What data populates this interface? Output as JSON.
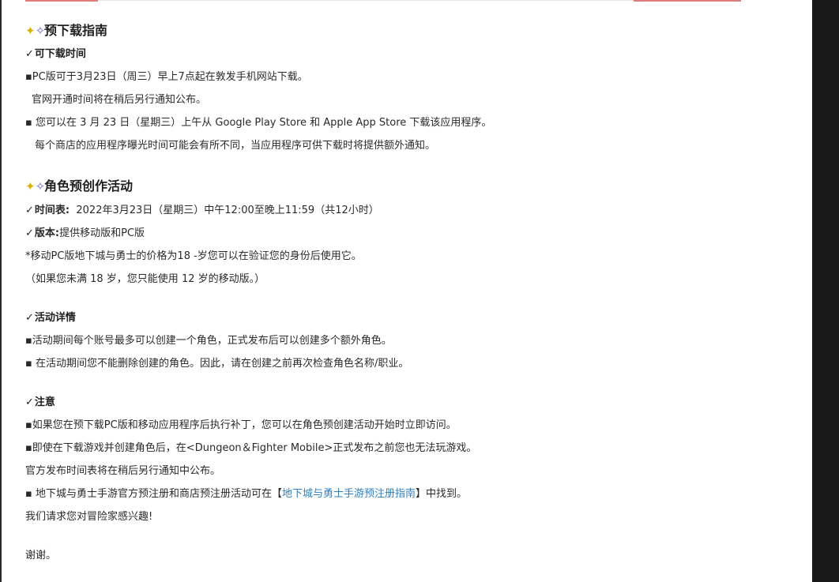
{
  "section1": {
    "title": "预下载指南",
    "subheading": "可下载时间",
    "lines": [
      "▪PC版可于3月23日（周三）早上7点起在敦发手机网站下载。",
      "官网开通时间将在稍后另行通知公布。",
      "▪ 您可以在 3 月 23 日（星期三）上午从 Google Play Store 和 Apple App Store 下载该应用程序。",
      "每个商店的应用程序曝光时间可能会有所不同，当应用程序可供下载时将提供额外通知。"
    ]
  },
  "section2": {
    "title": "角色预创作活动",
    "schedule_label": "时间表:",
    "schedule_value": "2022年3月23日（星期三）中午12:00至晚上11:59（共12小时）",
    "version_label": "版本:",
    "version_value": "提供移动版和PC版",
    "notes": [
      "*移动PC版地下城与勇士的价格为18 -岁您可以在验证您的身份后使用它。",
      "（如果您未满 18 岁，您只能使用 12 岁的移动版。）"
    ]
  },
  "section3": {
    "subheading": "活动详情",
    "lines": [
      "▪活动期间每个账号最多可以创建一个角色，正式发布后可以创建多个额外角色。",
      "▪ 在活动期间您不能删除创建的角色。因此，请在创建之前再次检查角色名称/职业。"
    ]
  },
  "section4": {
    "subheading": "注意",
    "lines": [
      "▪如果您在预下载PC版和移动应用程序后执行补丁，您可以在角色预创建活动开始时立即访问。",
      "▪即使在下载游戏并创建角色后，在<Dungeon＆Fighter Mobile>正式发布之前您也无法玩游戏。",
      "官方发布时间表将在稍后另行通知中公布。"
    ],
    "guide_prefix": "▪ 地下城与勇士手游官方预注册和商店预注册活动可在【",
    "guide_link": "地下城与勇士手游预注册指南",
    "guide_suffix": "】中找到。",
    "interest_line": "我们请求您对冒险家感兴趣!"
  },
  "closing": "谢谢。",
  "check_mark": "✓",
  "sparkle_icon": "sparkles-icon",
  "colors": {
    "link": "#2d7fc1",
    "accent_bar": "#e07c7c",
    "side_panel": "#181818"
  }
}
